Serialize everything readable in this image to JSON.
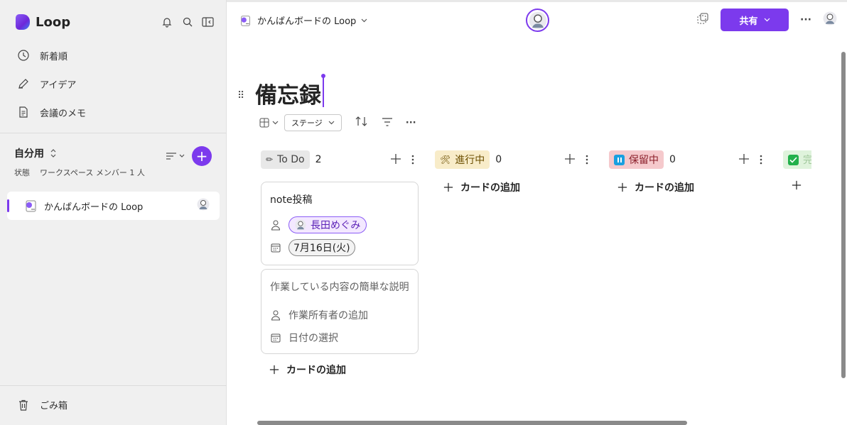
{
  "app": {
    "name": "Loop",
    "brand_color": "#7c3aed"
  },
  "sidebar": {
    "nav": [
      {
        "label": "新着順",
        "icon": "clock-icon"
      },
      {
        "label": "アイデア",
        "icon": "pen-icon"
      },
      {
        "label": "会議のメモ",
        "icon": "note-icon"
      }
    ],
    "workspace": {
      "title": "自分用",
      "status_label": "状態",
      "members": "ワークスペース メンバー 1 人",
      "add_label": "+"
    },
    "pages": [
      {
        "label": "かんばんボードの Loop"
      }
    ],
    "trash_label": "ごみ箱"
  },
  "topbar": {
    "breadcrumb": "かんばんボードの Loop",
    "share_label": "共有",
    "more_label": "···"
  },
  "page": {
    "title": "備忘録",
    "toolbar": {
      "stage_label": "ステージ",
      "more_label": "···"
    }
  },
  "board": {
    "add_card_label": "カードの追加",
    "columns": [
      {
        "label": "To Do",
        "count": "2",
        "emoji": "✏",
        "tag_bg": "#e8e8e8",
        "tag_color": "#424242",
        "cards": [
          {
            "title": "note投稿",
            "assignee": "長田めぐみ",
            "date": "7月16日(火)"
          },
          {
            "title": "作業している内容の簡単な説明",
            "assignee_placeholder": "作業所有者の追加",
            "date_placeholder": "日付の選択"
          }
        ]
      },
      {
        "label": "進行中",
        "count": "0",
        "emoji": "🛠",
        "tag_bg": "#f8ecc9",
        "tag_color": "#6b4e00"
      },
      {
        "label": "保留中",
        "count": "0",
        "emoji": "⏸",
        "tag_bg": "#f5c9cc",
        "tag_color": "#8a1f2a"
      }
    ]
  }
}
